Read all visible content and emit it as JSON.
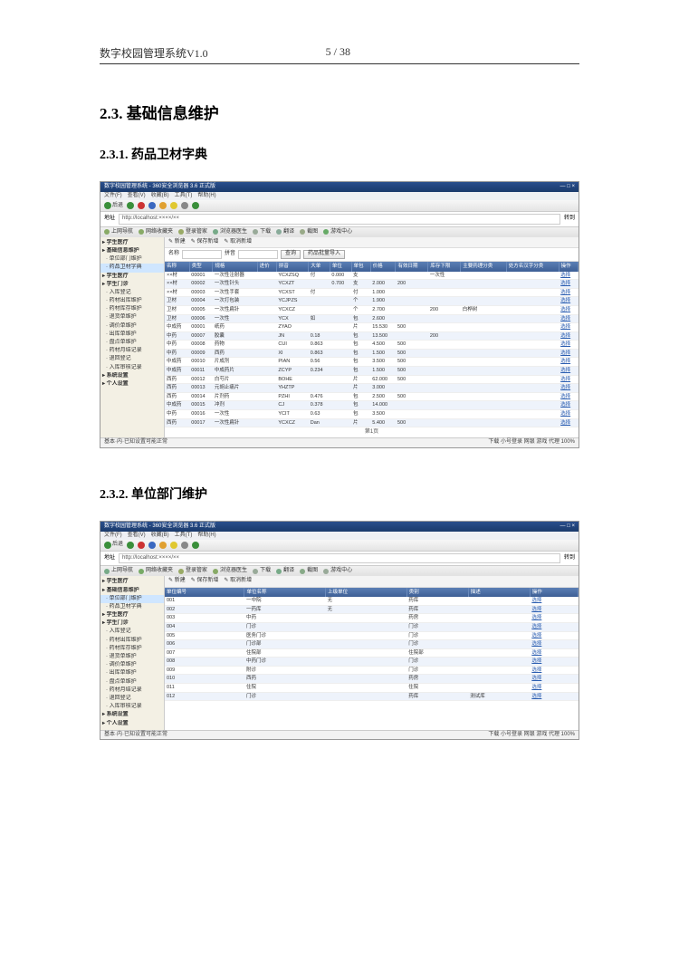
{
  "doc": {
    "header_title": "数字校园管理系统V1.0",
    "page_indicator": "5 / 38",
    "section_2_3": "2.3. 基础信息维护",
    "section_2_3_1": "2.3.1. 药品卫材字典",
    "section_2_3_2": "2.3.2. 单位部门维护"
  },
  "browser": {
    "title_prefix": "数字校园管理系统",
    "title_suffix": "360安全浏览器 3.6 正式版",
    "menu": [
      "文件(F)",
      "查看(V)",
      "收藏(B)",
      "工具(T)",
      "帮助(H)"
    ],
    "back": "后退",
    "addr_label": "地址",
    "addr_value": "http://localhost:××××/××",
    "go_label": "转到",
    "tabs": [
      "上网导航",
      "网络收藏夹",
      "登录管家",
      "浏览器医生",
      "下载",
      "翻译",
      "截图",
      "游戏中心"
    ],
    "status_left": "基本·内·已知设置可能正常",
    "status_right": "下载  小号登录  网银  游戏  代理  100%"
  },
  "shot1": {
    "sidebar": [
      {
        "t": "学生医疗",
        "lv": 1
      },
      {
        "t": "基础信息维护",
        "lv": 1
      },
      {
        "t": "单位部门维护"
      },
      {
        "t": "药品卫材字典",
        "sel": true
      },
      {
        "t": "学生医疗",
        "lv": 1
      },
      {
        "t": "学生门诊",
        "lv": 1
      },
      {
        "t": "入库登记"
      },
      {
        "t": "药材出库维护"
      },
      {
        "t": "药材库存维护"
      },
      {
        "t": "退货单维护"
      },
      {
        "t": "调价单维护"
      },
      {
        "t": "出库单维护"
      },
      {
        "t": "盘点单维护"
      },
      {
        "t": "药材月结记录"
      },
      {
        "t": "退回登记"
      },
      {
        "t": "入库审核记录"
      },
      {
        "t": "系统设置",
        "lv": 1
      },
      {
        "t": "个人设置",
        "lv": 1
      }
    ],
    "actions": [
      "新建",
      "保存新增",
      "取消新增"
    ],
    "filter_labels": {
      "name": "名称",
      "spell": "拼音",
      "query": "查询",
      "import": "药品批量导入"
    },
    "columns": [
      "名称",
      "类型",
      "规格",
      "进价",
      "拼音",
      "大单",
      "单位",
      "单包",
      "价格",
      "有效日期",
      "库存下限",
      "主要药理分类",
      "处方名汉字分类",
      "操作"
    ],
    "rows": [
      [
        "××材",
        "00001",
        "一次性注射器",
        "",
        "YCXZSQ",
        "付",
        "0.000",
        "支",
        "",
        "",
        "一次性",
        "",
        "",
        "选择"
      ],
      [
        "××材",
        "00002",
        "一次性针头",
        "",
        "YCXZT",
        "",
        "0.700",
        "支",
        "2.000",
        "200",
        "",
        "",
        "",
        "选择"
      ],
      [
        "××材",
        "00003",
        "一次性手套",
        "",
        "YCXST",
        "付",
        "",
        "付",
        "1.000",
        "",
        "",
        "",
        "",
        "选择"
      ],
      [
        "卫材",
        "00004",
        "一次打包装",
        "",
        "YCJPZS",
        "",
        "",
        "个",
        "1.900",
        "",
        "",
        "",
        "",
        "选择"
      ],
      [
        "卫材",
        "00005",
        "一次性扁针",
        "",
        "YCXCZ",
        "",
        "",
        "个",
        "2.700",
        "",
        "200",
        "白桦树",
        "",
        "选择"
      ],
      [
        "卫材",
        "00006",
        "一次性",
        "",
        "YCX",
        "如",
        "",
        "包",
        "2.600",
        "",
        "",
        "",
        "",
        "选择"
      ],
      [
        "中成药",
        "00001",
        "纸药",
        "",
        "ZYAO",
        "",
        "",
        "片",
        "15.530",
        "500",
        "",
        "",
        "",
        "选择"
      ],
      [
        "中药",
        "00007",
        "胶囊",
        "",
        "JN",
        "0.18",
        "",
        "包",
        "13.500",
        "",
        "200",
        "",
        "",
        "选择"
      ],
      [
        "中药",
        "00008",
        "药物",
        "",
        "CUI",
        "0.863",
        "",
        "包",
        "4.500",
        "500",
        "",
        "",
        "",
        "选择"
      ],
      [
        "中药",
        "00009",
        "西药",
        "",
        "XI",
        "0.863",
        "",
        "包",
        "1.500",
        "500",
        "",
        "",
        "",
        "选择"
      ],
      [
        "中成药",
        "00010",
        "片成剂",
        "",
        "PIAN",
        "0.56",
        "",
        "包",
        "3.500",
        "500",
        "",
        "",
        "",
        "选择"
      ],
      [
        "中成药",
        "00011",
        "中成药片",
        "",
        "ZCYP",
        "0.234",
        "",
        "包",
        "1.500",
        "500",
        "",
        "",
        "",
        "选择"
      ],
      [
        "西药",
        "00012",
        "白芍片",
        "",
        "BOHE",
        "",
        "",
        "片",
        "62.000",
        "500",
        "",
        "",
        "",
        "选择"
      ],
      [
        "西药",
        "00013",
        "元胡止痛片",
        "",
        "YHZTP",
        "",
        "",
        "片",
        "3.000",
        "",
        "",
        "",
        "",
        "选择"
      ],
      [
        "西药",
        "00014",
        "片剂药",
        "",
        "PZHI",
        "0.476",
        "",
        "包",
        "2.500",
        "500",
        "",
        "",
        "",
        "选择"
      ],
      [
        "中成药",
        "00015",
        "冲剂",
        "",
        "CJ",
        "0.378",
        "",
        "包",
        "14.000",
        "",
        "",
        "",
        "",
        "选择"
      ],
      [
        "中药",
        "00016",
        "一次性",
        "",
        "YCIT",
        "0.63",
        "",
        "包",
        "3.500",
        "",
        "",
        "",
        "",
        "选择"
      ],
      [
        "西药",
        "00017",
        "一次性扁针",
        "",
        "YCXCZ",
        "Dan",
        "",
        "片",
        "5.400",
        "500",
        "",
        "",
        "",
        "选择"
      ]
    ],
    "pager": "第1页"
  },
  "shot2": {
    "sidebar": [
      {
        "t": "学生医疗",
        "lv": 1
      },
      {
        "t": "基础信息维护",
        "lv": 1
      },
      {
        "t": "单位部门维护",
        "sel": true
      },
      {
        "t": "药品卫材字典"
      },
      {
        "t": "学生医疗",
        "lv": 1
      },
      {
        "t": "学生门诊",
        "lv": 1
      },
      {
        "t": "入库登记"
      },
      {
        "t": "药材出库维护"
      },
      {
        "t": "药材库存维护"
      },
      {
        "t": "退货单维护"
      },
      {
        "t": "调价单维护"
      },
      {
        "t": "出库单维护"
      },
      {
        "t": "盘点单维护"
      },
      {
        "t": "药材月结记录"
      },
      {
        "t": "退回登记"
      },
      {
        "t": "入库审核记录"
      },
      {
        "t": "系统设置",
        "lv": 1
      },
      {
        "t": "个人设置",
        "lv": 1
      }
    ],
    "actions": [
      "新建",
      "保存新增",
      "取消新增"
    ],
    "columns": [
      "单位编号",
      "单位名称",
      "上级单位",
      "类别",
      "描述",
      "操作"
    ],
    "rows": [
      [
        "001",
        "一中院",
        "无",
        "药库",
        "",
        "选择"
      ],
      [
        "002",
        "一药库",
        "无",
        "药库",
        "",
        "选择"
      ],
      [
        "003",
        "中药",
        "",
        "药房",
        "",
        "选择"
      ],
      [
        "004",
        "门诊",
        "",
        "门诊",
        "",
        "选择"
      ],
      [
        "005",
        "医务门诊",
        "",
        "门诊",
        "",
        "选择"
      ],
      [
        "006",
        "门诊部",
        "",
        "门诊",
        "",
        "选择"
      ],
      [
        "007",
        "住院部",
        "",
        "住院部",
        "",
        "选择"
      ],
      [
        "008",
        "中药门诊",
        "",
        "门诊",
        "",
        "选择"
      ],
      [
        "009",
        "附诊",
        "",
        "门诊",
        "",
        "选择"
      ],
      [
        "010",
        "西药",
        "",
        "药房",
        "",
        "选择"
      ],
      [
        "011",
        "住院",
        "",
        "住院",
        "",
        "选择"
      ],
      [
        "012",
        "门诊",
        "",
        "药库",
        "测试库",
        "选择"
      ]
    ]
  }
}
